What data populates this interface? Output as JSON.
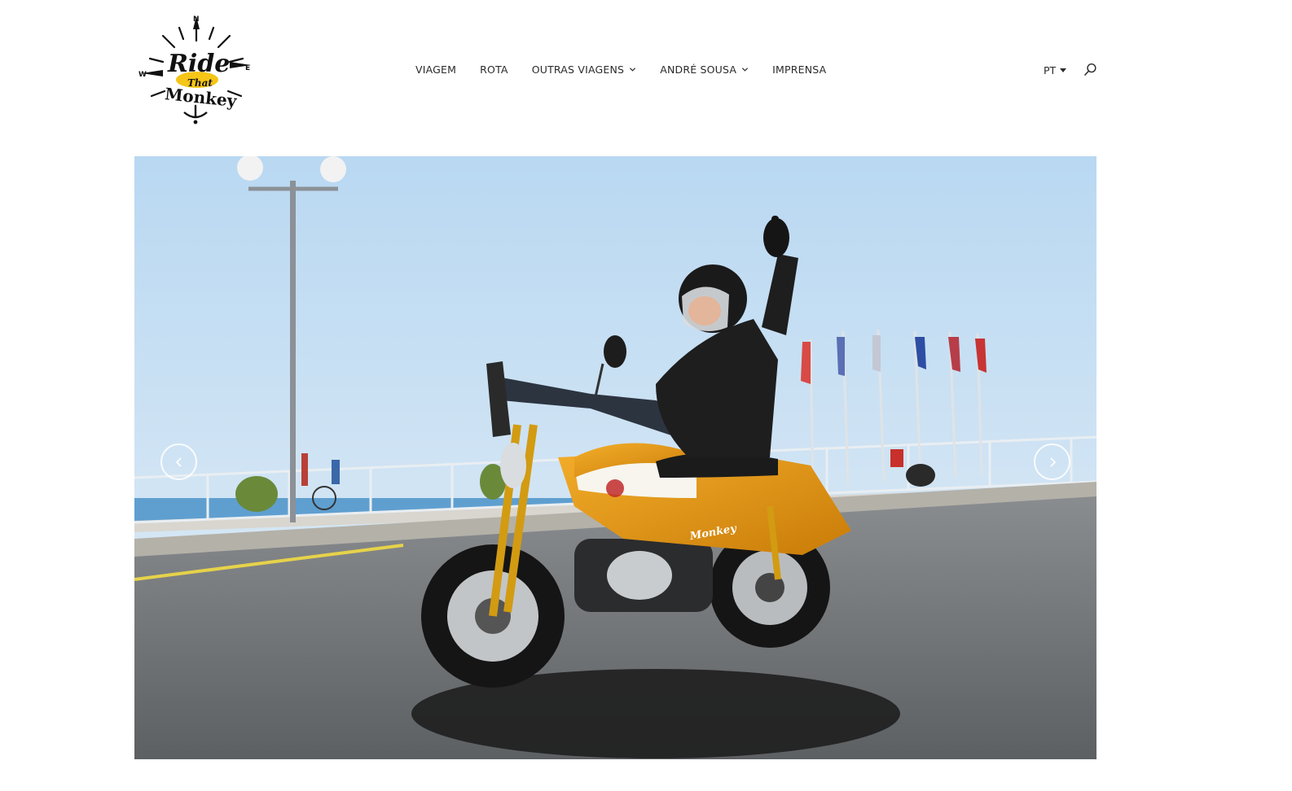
{
  "brand": {
    "logo_line1": "Ride",
    "logo_line2": "That",
    "logo_line3": "Monkey",
    "compass": {
      "north": "N",
      "south": "S",
      "east": "E",
      "west": "W"
    },
    "accent_color": "#f5c518"
  },
  "nav": {
    "items": [
      {
        "label": "VIAGEM",
        "has_dropdown": false
      },
      {
        "label": "ROTA",
        "has_dropdown": false
      },
      {
        "label": "OUTRAS VIAGENS",
        "has_dropdown": true
      },
      {
        "label": "ANDRÉ SOUSA",
        "has_dropdown": true
      },
      {
        "label": "IMPRENSA",
        "has_dropdown": false
      }
    ]
  },
  "language": {
    "current": "PT"
  },
  "icons": {
    "search": "search-icon",
    "prev": "chevron-left-icon",
    "next": "chevron-right-icon",
    "dropdown": "chevron-down-icon"
  },
  "hero": {
    "bike_badge": "Monkey",
    "colors": {
      "sky": "#cfe3f3",
      "road": "#7c7f82",
      "bike": "#e89a12"
    }
  }
}
